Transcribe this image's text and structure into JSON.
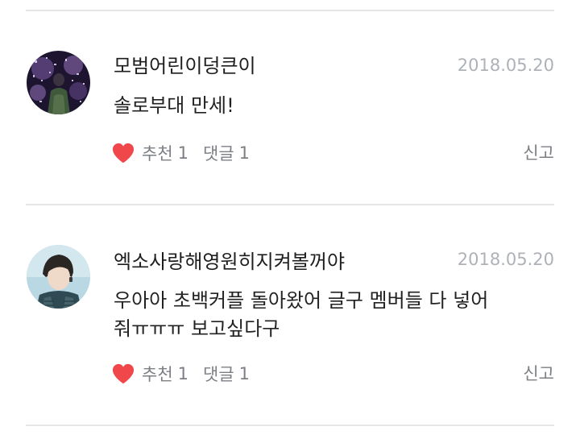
{
  "comments": [
    {
      "username": "모범어린이덩큰이",
      "date": "2018.05.20",
      "text": "솔로부대 만세!",
      "like_label": "추천",
      "like_count": "1",
      "reply_label": "댓글",
      "reply_count": "1",
      "report_label": "신고"
    },
    {
      "username": "엑소사랑해영원히지켜볼꺼야",
      "date": "2018.05.20",
      "text": "우아아 초백커플 돌아왔어 글구 멤버들 다 넣어줘ㅠㅠㅠ 보고싶다구",
      "like_label": "추천",
      "like_count": "1",
      "reply_label": "댓글",
      "reply_count": "1",
      "report_label": "신고"
    }
  ],
  "colors": {
    "heart": "#f0474b",
    "date": "#aeb2b8",
    "action_text": "#7c7f84",
    "divider": "#e6e6e6"
  }
}
